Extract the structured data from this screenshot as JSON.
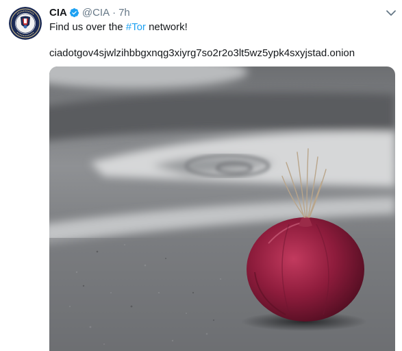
{
  "tweet": {
    "author_name": "CIA",
    "handle": "@CIA",
    "separator": "·",
    "time": "7h",
    "text_before_hashtag": "Find us over the ",
    "hashtag": "#Tor",
    "text_after_hashtag": " network!",
    "onion_address": "ciadotgov4sjwlzihbbgxnqg3xiyrg7so2r2o3lt5wz5ypk4sxyjstad.onion"
  },
  "icons": {
    "avatar": "cia-seal-avatar",
    "verified": "verified-badge-icon",
    "menu": "chevron-down-icon"
  },
  "colors": {
    "accent": "#1da1f2",
    "secondary_text": "#657786",
    "primary_text": "#14171a"
  }
}
